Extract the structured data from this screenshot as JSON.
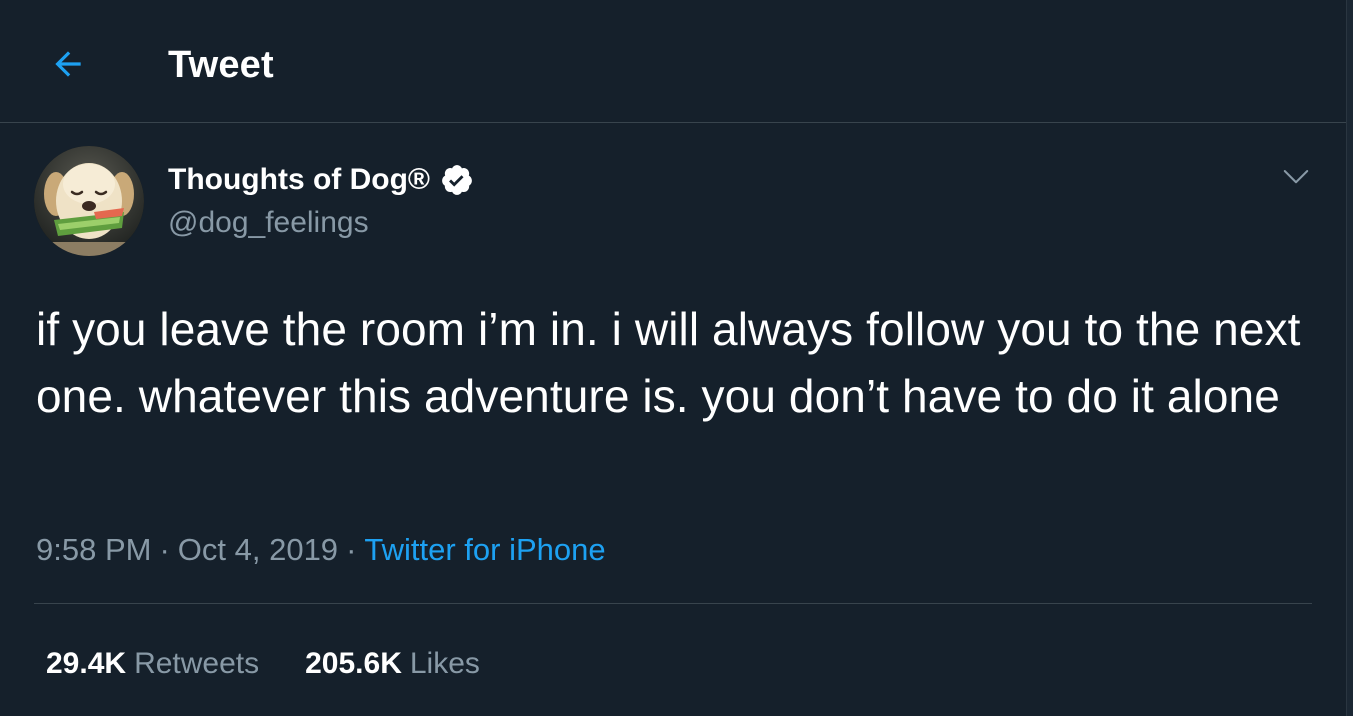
{
  "header": {
    "back_icon": "arrow-left-icon",
    "title": "Tweet"
  },
  "tweet": {
    "avatar_icon": "dog-avatar-image",
    "display_name": "Thoughts of Dog®",
    "verified_icon": "verified-badge-icon",
    "handle": "@dog_feelings",
    "menu_icon": "chevron-down-icon",
    "text": "if you leave the room i’m in. i will always follow you to the next one. whatever this adventure is. you don’t have to do it alone",
    "time": "9:58 PM",
    "separator": "·",
    "date": "Oct 4, 2019",
    "source": "Twitter for iPhone",
    "retweets_count": "29.4K",
    "retweets_label": "Retweets",
    "likes_count": "205.6K",
    "likes_label": "Likes"
  },
  "colors": {
    "background": "#15202b",
    "accent": "#1da1f2",
    "secondary_text": "#8899a6",
    "border": "#38444d"
  }
}
